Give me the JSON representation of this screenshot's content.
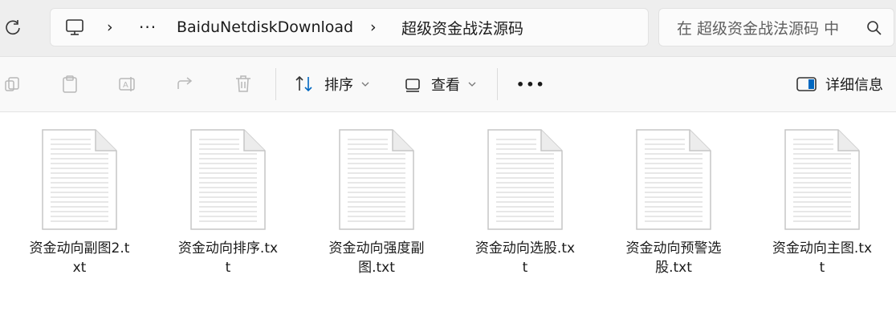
{
  "address_bar": {
    "path_items": [
      "BaiduNetdiskDownload",
      "超级资金战法源码"
    ],
    "ellipsis": "···",
    "separator": "›"
  },
  "search": {
    "placeholder": "在 超级资金战法源码 中"
  },
  "toolbar": {
    "sort_label": "排序",
    "view_label": "查看",
    "more_label": "•••",
    "details_label": "详细信息"
  },
  "files": [
    {
      "name": "资金动向副图2.txt"
    },
    {
      "name": "资金动向排序.txt"
    },
    {
      "name": "资金动向强度副图.txt"
    },
    {
      "name": "资金动向选股.txt"
    },
    {
      "name": "资金动向预警选股.txt"
    },
    {
      "name": "资金动向主图.txt"
    }
  ],
  "icons": {
    "refresh": "refresh-icon",
    "pc": "this-pc-icon",
    "search": "search-icon",
    "copy": "copy-icon",
    "paste": "paste-icon",
    "rename": "rename-icon",
    "share": "share-icon",
    "delete": "delete-icon",
    "sort": "sort-icon",
    "view": "view-icon",
    "details": "details-pane-icon",
    "file": "text-file-icon"
  },
  "colors": {
    "window_bg": "#f3f3f3",
    "content_bg": "#ffffff",
    "accent_icon": "#0067c0"
  }
}
